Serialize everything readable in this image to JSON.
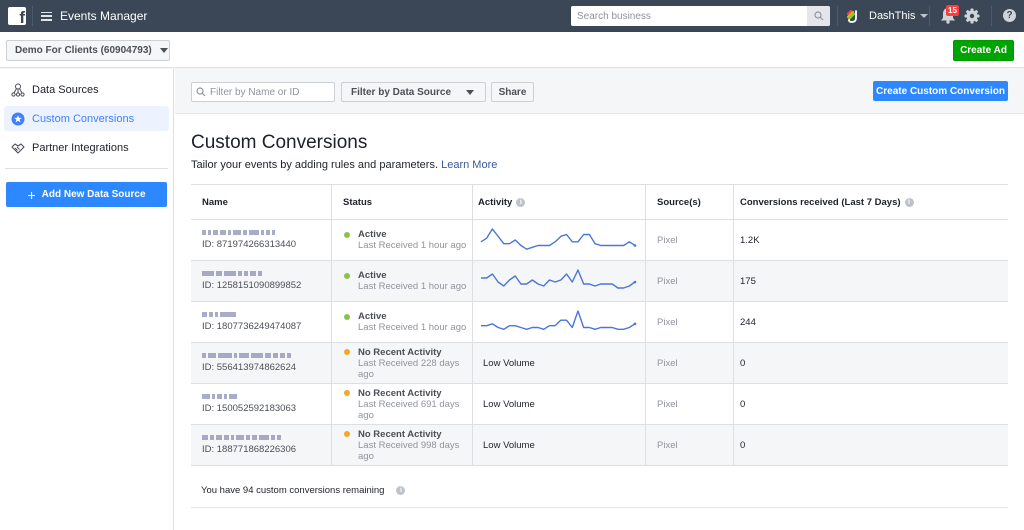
{
  "topbar": {
    "logo_icon": "facebook-f-icon",
    "menu_icon": "hamburger-icon",
    "app_title": "Events Manager",
    "search_placeholder": "Search business",
    "search_icon": "magnifier-icon",
    "account_name": "DashThis",
    "notification_count": "15",
    "bell_icon": "bell-icon",
    "settings_icon": "gear-icon",
    "help_label": "?"
  },
  "account_bar": {
    "ad_account": "Demo For Clients (60904793)",
    "create_ad_label": "Create Ad"
  },
  "sidebar": {
    "items": [
      {
        "label": "Data Sources",
        "icon": "data-sources-icon",
        "active": false
      },
      {
        "label": "Custom Conversions",
        "icon": "star-badge-icon",
        "active": true
      },
      {
        "label": "Partner Integrations",
        "icon": "handshake-icon",
        "active": false
      }
    ],
    "add_button_label": "Add New Data Source",
    "add_button_icon": "+"
  },
  "toolbar": {
    "filter_placeholder": "Filter by Name or ID",
    "filter_source_label": "Filter by Data Source",
    "share_label": "Share",
    "create_cc_label": "Create Custom Conversion"
  },
  "page": {
    "title": "Custom Conversions",
    "subtitle": "Tailor your events by adding rules and parameters.",
    "learn_more": "Learn More"
  },
  "table": {
    "headers": {
      "name": "Name",
      "status": "Status",
      "activity": "Activity",
      "sources": "Source(s)",
      "conversions": "Conversions received (Last 7 Days)"
    },
    "info_icon": "i",
    "rows": [
      {
        "name_redacted": true,
        "id": "ID: 871974266313440",
        "status": "Active",
        "status_color": "#8bc34a",
        "last_received": "Last Received 1 hour ago",
        "activity_type": "sparkline",
        "activity_text": "",
        "spark": [
          5,
          7,
          12,
          8,
          4,
          4,
          6,
          3,
          1,
          2,
          3,
          3,
          3,
          5,
          8,
          9,
          5,
          5,
          9,
          9,
          4,
          3,
          3,
          3,
          3,
          3,
          5,
          3
        ],
        "source": "Pixel",
        "conversions": "1.2K"
      },
      {
        "name_redacted": true,
        "id": "ID: 1258151090899852",
        "status": "Active",
        "status_color": "#8bc34a",
        "last_received": "Last Received 1 hour ago",
        "activity_type": "sparkline",
        "activity_text": "",
        "spark": [
          7,
          7,
          9,
          5,
          3,
          6,
          8,
          4,
          4,
          6,
          4,
          3,
          6,
          5,
          6,
          9,
          5,
          11,
          4,
          4,
          3,
          4,
          4,
          4,
          2,
          2,
          3,
          5
        ],
        "source": "Pixel",
        "conversions": "175"
      },
      {
        "name_redacted": true,
        "id": "ID: 1807736249474087",
        "status": "Active",
        "status_color": "#8bc34a",
        "last_received": "Last Received 1 hour ago",
        "activity_type": "sparkline",
        "activity_text": "",
        "spark": [
          4,
          4,
          5,
          3,
          2,
          4,
          4,
          3,
          2,
          3,
          3,
          2,
          4,
          4,
          7,
          7,
          3,
          12,
          3,
          3,
          2,
          3,
          3,
          3,
          2,
          2,
          3,
          5
        ],
        "source": "Pixel",
        "conversions": "244"
      },
      {
        "name_redacted": true,
        "id": "ID: 556413974862624",
        "status": "No Recent Activity",
        "status_color": "#f5a623",
        "last_received": "Last Received 228 days ago",
        "activity_type": "text",
        "activity_text": "Low Volume",
        "spark": [],
        "source": "Pixel",
        "conversions": "0"
      },
      {
        "name_redacted": true,
        "id": "ID: 150052592183063",
        "status": "No Recent Activity",
        "status_color": "#f5a623",
        "last_received": "Last Received 691 days ago",
        "activity_type": "text",
        "activity_text": "Low Volume",
        "spark": [],
        "source": "Pixel",
        "conversions": "0"
      },
      {
        "name_redacted": true,
        "id": "ID: 188771868226306",
        "status": "No Recent Activity",
        "status_color": "#f5a623",
        "last_received": "Last Received 998 days ago",
        "activity_type": "text",
        "activity_text": "Low Volume",
        "spark": [],
        "source": "Pixel",
        "conversions": "0"
      }
    ]
  },
  "footer": {
    "remaining_text": "You have 94 custom conversions remaining"
  },
  "colors": {
    "topbar": "#3b4757",
    "primary_blue": "#2d88ff",
    "create_ad_green": "#00a400",
    "active_green": "#8bc34a",
    "warning_orange": "#f5a623",
    "sparkline": "#4a76d9",
    "badge_red": "#fa3e3e"
  }
}
